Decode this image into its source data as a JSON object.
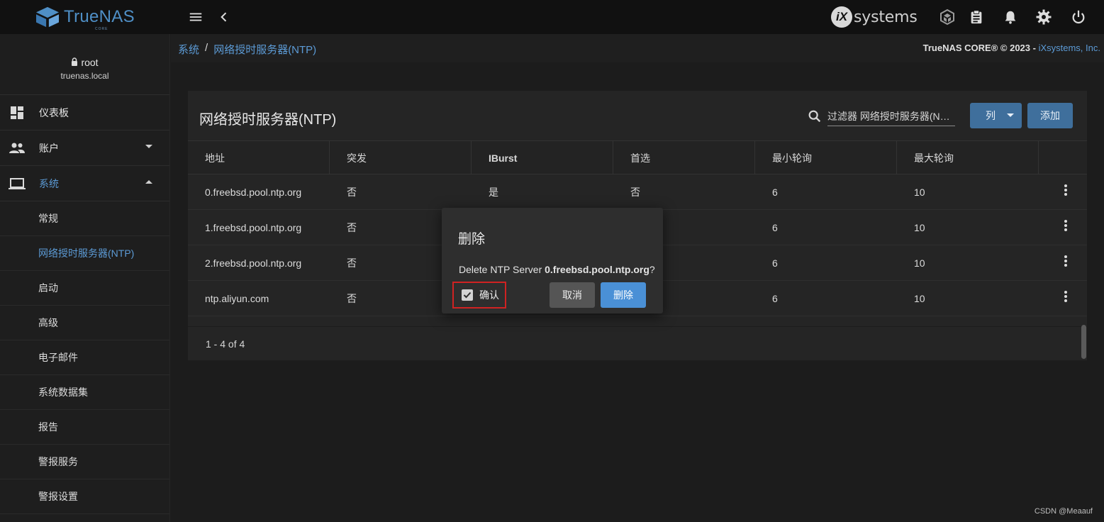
{
  "app": {
    "logo_text": "TrueNAS",
    "logo_subtext": "CORE",
    "vendor_logo_badge": "iX",
    "vendor_logo_word": "systems"
  },
  "topbar": {
    "icons": [
      "menu-icon",
      "back-chevron-icon",
      "truecommand-icon",
      "clipboard-icon",
      "bell-icon",
      "gear-icon",
      "power-icon"
    ]
  },
  "user": {
    "name": "root",
    "host": "truenas.local"
  },
  "sidebar": {
    "items": [
      {
        "label": "仪表板",
        "icon": "dashboard-icon"
      },
      {
        "label": "账户",
        "icon": "people-icon"
      },
      {
        "label": "系统",
        "icon": "laptop-icon"
      }
    ],
    "sub_items": [
      {
        "label": "常规"
      },
      {
        "label": "网络授时服务器(NTP)"
      },
      {
        "label": "启动"
      },
      {
        "label": "高级"
      },
      {
        "label": "电子邮件"
      },
      {
        "label": "系统数据集"
      },
      {
        "label": "报告"
      },
      {
        "label": "警报服务"
      },
      {
        "label": "警报设置"
      }
    ]
  },
  "breadcrumb": {
    "root": "系统",
    "separator": "/",
    "current": "网络授时服务器(NTP)"
  },
  "copyright": {
    "text": "TrueNAS CORE® © 2023 - ",
    "link": "iXsystems, Inc."
  },
  "card": {
    "title": "网络授时服务器(NTP)",
    "filter_placeholder": "过滤器 网络授时服务器(NTP)",
    "columns_button": "列",
    "add_button": "添加"
  },
  "table": {
    "headers": [
      "地址",
      "突发",
      "IBurst",
      "首选",
      "最小轮询",
      "最大轮询"
    ],
    "rows": [
      {
        "address": "0.freebsd.pool.ntp.org",
        "burst": "否",
        "iburst": "是",
        "prefer": "否",
        "minpoll": "6",
        "maxpoll": "10"
      },
      {
        "address": "1.freebsd.pool.ntp.org",
        "burst": "否",
        "iburst": "",
        "prefer": "",
        "minpoll": "6",
        "maxpoll": "10"
      },
      {
        "address": "2.freebsd.pool.ntp.org",
        "burst": "否",
        "iburst": "",
        "prefer": "",
        "minpoll": "6",
        "maxpoll": "10"
      },
      {
        "address": "ntp.aliyun.com",
        "burst": "否",
        "iburst": "",
        "prefer": "",
        "minpoll": "6",
        "maxpoll": "10"
      }
    ],
    "paginator": "1 - 4 of 4"
  },
  "dialog": {
    "title": "删除",
    "message_prefix": "Delete NTP Server ",
    "message_target": "0.freebsd.pool.ntp.org",
    "message_suffix": "?",
    "confirm_label": "确认",
    "confirm_checked": true,
    "cancel_label": "取消",
    "delete_label": "删除"
  },
  "watermark": "CSDN @Meaauf",
  "colors": {
    "accent": "#5c9bd6",
    "button_primary": "#3f6f9c",
    "dialog_delete": "#4a90d6",
    "highlight_border": "#d02222"
  }
}
